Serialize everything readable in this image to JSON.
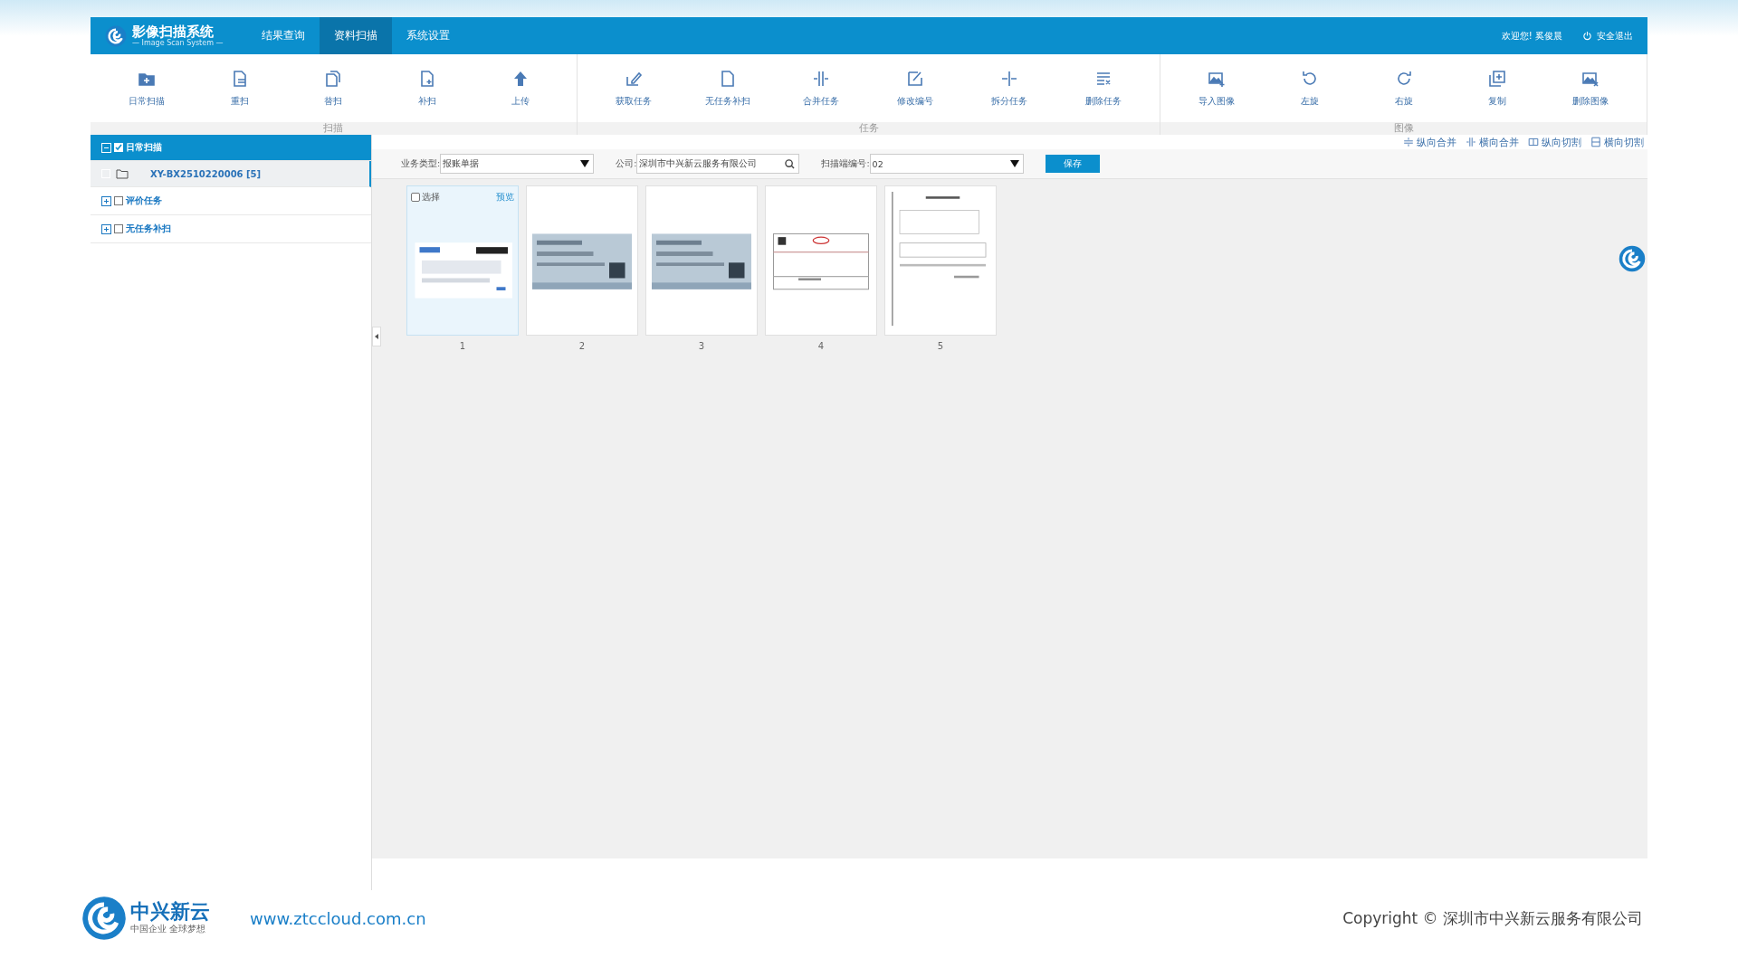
{
  "app": {
    "title": "影像扫描系统",
    "subtitle": "— Image Scan System —"
  },
  "nav": [
    {
      "label": "结果查询",
      "selected": false
    },
    {
      "label": "资料扫描",
      "selected": true
    },
    {
      "label": "系统设置",
      "selected": false
    }
  ],
  "user": {
    "greeting": "欢迎您! 奚俊晨",
    "logout": "安全退出"
  },
  "toolbar_groups": [
    {
      "label": "扫描",
      "items": [
        "日常扫描",
        "重扫",
        "替扫",
        "补扫",
        "上传"
      ]
    },
    {
      "label": "任务",
      "items": [
        "获取任务",
        "无任务补扫",
        "合并任务",
        "修改编号",
        "拆分任务",
        "删除任务"
      ]
    },
    {
      "label": "图像",
      "items": [
        "导入图像",
        "左旋",
        "右旋",
        "复制",
        "删除图像"
      ]
    }
  ],
  "image_tools": [
    "纵向合并",
    "横向合并",
    "纵向切割",
    "横向切割"
  ],
  "tree": [
    {
      "label": "日常扫描",
      "expanded": true,
      "selected": true,
      "checked": true,
      "children": [
        {
          "label": "XY-BX2510220006 [5]",
          "selected": true,
          "checked": false
        }
      ]
    },
    {
      "label": "评价任务",
      "expanded": false,
      "selected": false,
      "checked": false
    },
    {
      "label": "无任务补扫",
      "expanded": false,
      "selected": false,
      "checked": false
    }
  ],
  "filters": [
    {
      "label": "业务类型:",
      "value": "报账单据",
      "kind": "select"
    },
    {
      "label": "公司:",
      "value": "深圳市中兴新云服务有限公司",
      "kind": "search"
    },
    {
      "label": "扫描端编号:",
      "value": "02",
      "kind": "select"
    }
  ],
  "save_button": "保存",
  "pages": [
    {
      "number": "1",
      "selected": true,
      "select_label": "选择",
      "checked": false,
      "preview": "预览"
    },
    {
      "number": "2",
      "selected": false
    },
    {
      "number": "3",
      "selected": false
    },
    {
      "number": "4",
      "selected": false
    },
    {
      "number": "5",
      "selected": false
    }
  ],
  "footer": {
    "brand": "中兴新云",
    "slogan": "中国企业 全球梦想",
    "url": "www.ztccloud.com.cn",
    "copyright": "Copyright © 深圳市中兴新云服务有限公司"
  }
}
